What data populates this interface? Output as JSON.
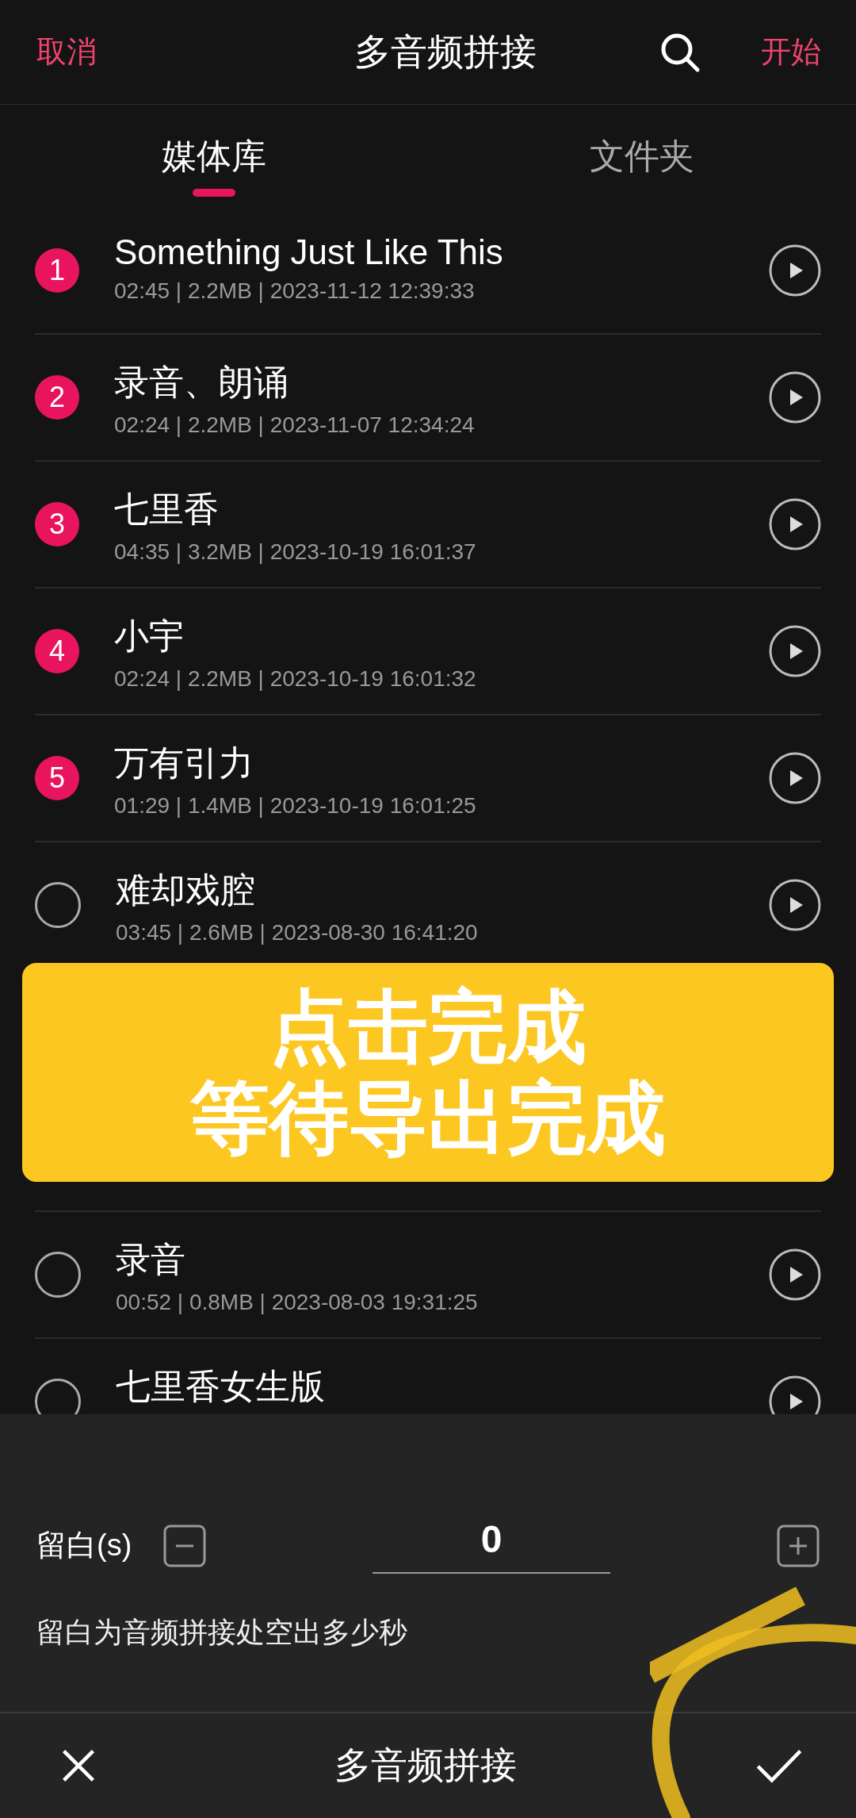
{
  "header": {
    "cancel": "取消",
    "title": "多音频拼接",
    "start": "开始"
  },
  "tabs": [
    {
      "label": "媒体库",
      "selected": true
    },
    {
      "label": "文件夹",
      "selected": false
    }
  ],
  "list": {
    "items_above": [
      {
        "order": "1",
        "title": "Something Just Like This",
        "meta": "02:45 | 2.2MB | 2023-11-12 12:39:33",
        "selected": true
      },
      {
        "order": "2",
        "title": "录音、朗诵",
        "meta": "02:24 | 2.2MB | 2023-11-07 12:34:24",
        "selected": true
      },
      {
        "order": "3",
        "title": "七里香",
        "meta": "04:35 | 3.2MB | 2023-10-19 16:01:37",
        "selected": true
      },
      {
        "order": "4",
        "title": "小宇",
        "meta": "02:24 | 2.2MB | 2023-10-19 16:01:32",
        "selected": true
      },
      {
        "order": "5",
        "title": "万有引力",
        "meta": "01:29 | 1.4MB | 2023-10-19 16:01:25",
        "selected": true
      },
      {
        "title": "难却戏腔",
        "meta": "03:45 | 2.6MB | 2023-08-30 16:41:20",
        "selected": false
      }
    ],
    "items_below": [
      {
        "title": "录音",
        "meta": "00:52 | 0.8MB | 2023-08-03 19:31:25",
        "selected": false
      },
      {
        "title": "七里香女生版",
        "selected": false
      }
    ]
  },
  "banner": {
    "lines": [
      "点击完成",
      "等待导出完成"
    ]
  },
  "gap_setting": {
    "label": "留白(s)",
    "value": "0",
    "hint": "留白为音频拼接处空出多少秒"
  },
  "bottom_bar": {
    "title": "多音频拼接"
  }
}
